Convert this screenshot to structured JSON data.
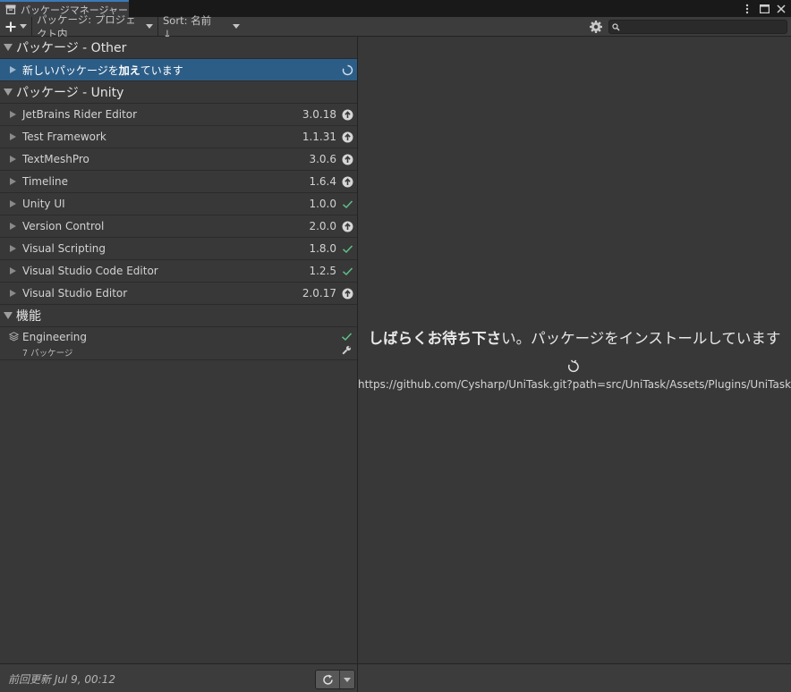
{
  "window": {
    "tab_title": "パッケージマネージャー"
  },
  "toolbar": {
    "add_symbol": "+",
    "scope_dropdown": "パッケージ: プロジェクト内",
    "sort_dropdown": "Sort: 名前 ↓",
    "search_placeholder": ""
  },
  "groups": {
    "other": {
      "title": "パッケージ - Other",
      "items": [
        {
          "prefix": "新しいパッケージを",
          "bold": "加え",
          "suffix": "ています",
          "status": "spinner-icon"
        }
      ]
    },
    "unity": {
      "title": "パッケージ - Unity",
      "items": [
        {
          "name": "JetBrains Rider Editor",
          "version": "3.0.18",
          "status": "update-available-icon"
        },
        {
          "name": "Test Framework",
          "version": "1.1.31",
          "status": "update-available-icon"
        },
        {
          "name": "TextMeshPro",
          "version": "3.0.6",
          "status": "update-available-icon"
        },
        {
          "name": "Timeline",
          "version": "1.6.4",
          "status": "update-available-icon"
        },
        {
          "name": "Unity UI",
          "version": "1.0.0",
          "status": "installed-check-icon"
        },
        {
          "name": "Version Control",
          "version": "2.0.0",
          "status": "update-available-icon"
        },
        {
          "name": "Visual Scripting",
          "version": "1.8.0",
          "status": "installed-check-icon"
        },
        {
          "name": "Visual Studio Code Editor",
          "version": "1.2.5",
          "status": "installed-check-icon"
        },
        {
          "name": "Visual Studio Editor",
          "version": "2.0.17",
          "status": "update-available-icon"
        }
      ]
    },
    "features": {
      "title": "機能",
      "items": [
        {
          "name": "Engineering",
          "subtitle": "7 パッケージ"
        }
      ]
    }
  },
  "details": {
    "wait_bold": "しばらくお待ち下さ",
    "wait_rest": "い。パッケージをインストールしています",
    "url": "https://github.com/Cysharp/UniTask.git?path=src/UniTask/Assets/Plugins/UniTask"
  },
  "footer": {
    "last_update": "前回更新 Jul 9, 00:12"
  },
  "colors": {
    "selection": "#2c5d87",
    "check": "#5ec28a",
    "tab_accent": "#3a79bb"
  }
}
